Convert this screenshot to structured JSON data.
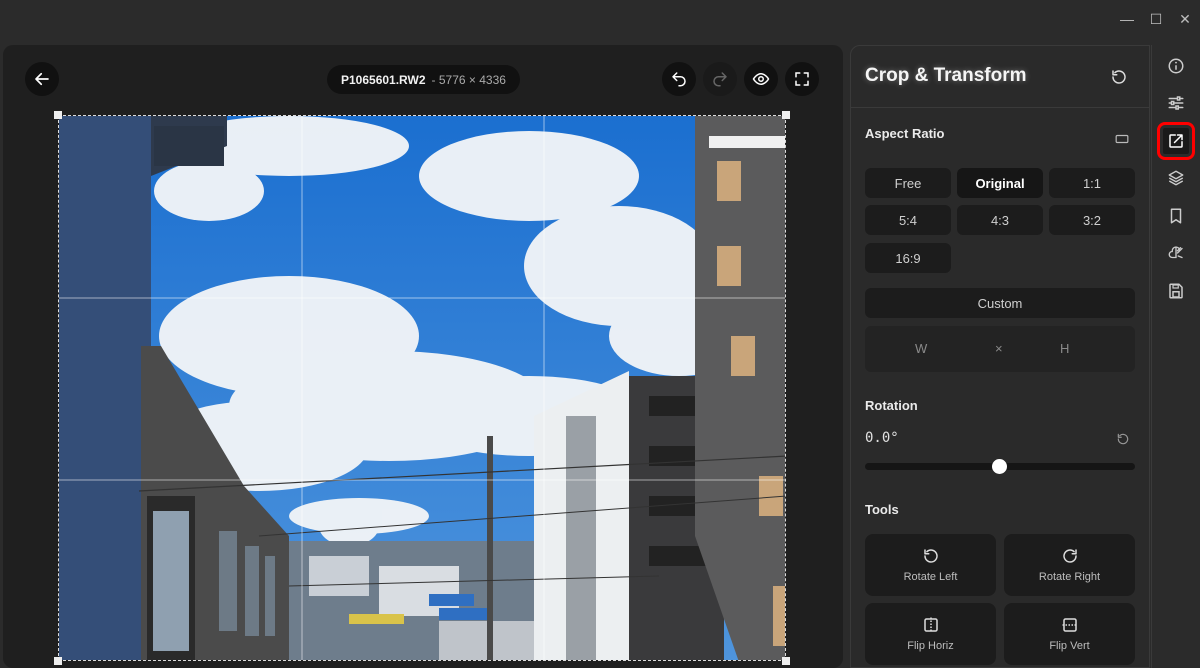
{
  "window": {
    "minimize_glyph": "—",
    "maximize_glyph": "☐",
    "close_glyph": "✕"
  },
  "canvas": {
    "file_name": "P1065601.RW2",
    "file_dims": "- 5776 × 4336",
    "icons": [
      "back-arrow-icon",
      "undo-icon",
      "redo-icon",
      "eye-icon",
      "fullscreen-icon"
    ]
  },
  "panel": {
    "title": "Crop & Transform",
    "aspect_ratio": {
      "title": "Aspect Ratio",
      "options": [
        "Free",
        "Original",
        "1:1",
        "5:4",
        "4:3",
        "3:2",
        "16:9"
      ],
      "selected": "Original",
      "custom_label": "Custom",
      "width_placeholder": "W",
      "times": "×",
      "height_placeholder": "H"
    },
    "rotation": {
      "title": "Rotation",
      "value": "0.0°",
      "slider_fraction": 0.5
    },
    "tools": {
      "title": "Tools",
      "rotate_left": "Rotate Left",
      "rotate_right": "Rotate Right",
      "flip_horiz": "Flip Horiz",
      "flip_vert": "Flip Vert"
    }
  },
  "rail": {
    "icons": [
      "info-icon",
      "adjustments-icon",
      "crop-transform-icon",
      "layers-icon",
      "bookmark-icon",
      "ai-icon",
      "save-icon"
    ],
    "active": "crop-transform-icon"
  },
  "colors": {
    "accent_highlight": "#ff0000",
    "panel_bg": "#2a2a2a",
    "canvas_bg": "#1f1f1f"
  }
}
